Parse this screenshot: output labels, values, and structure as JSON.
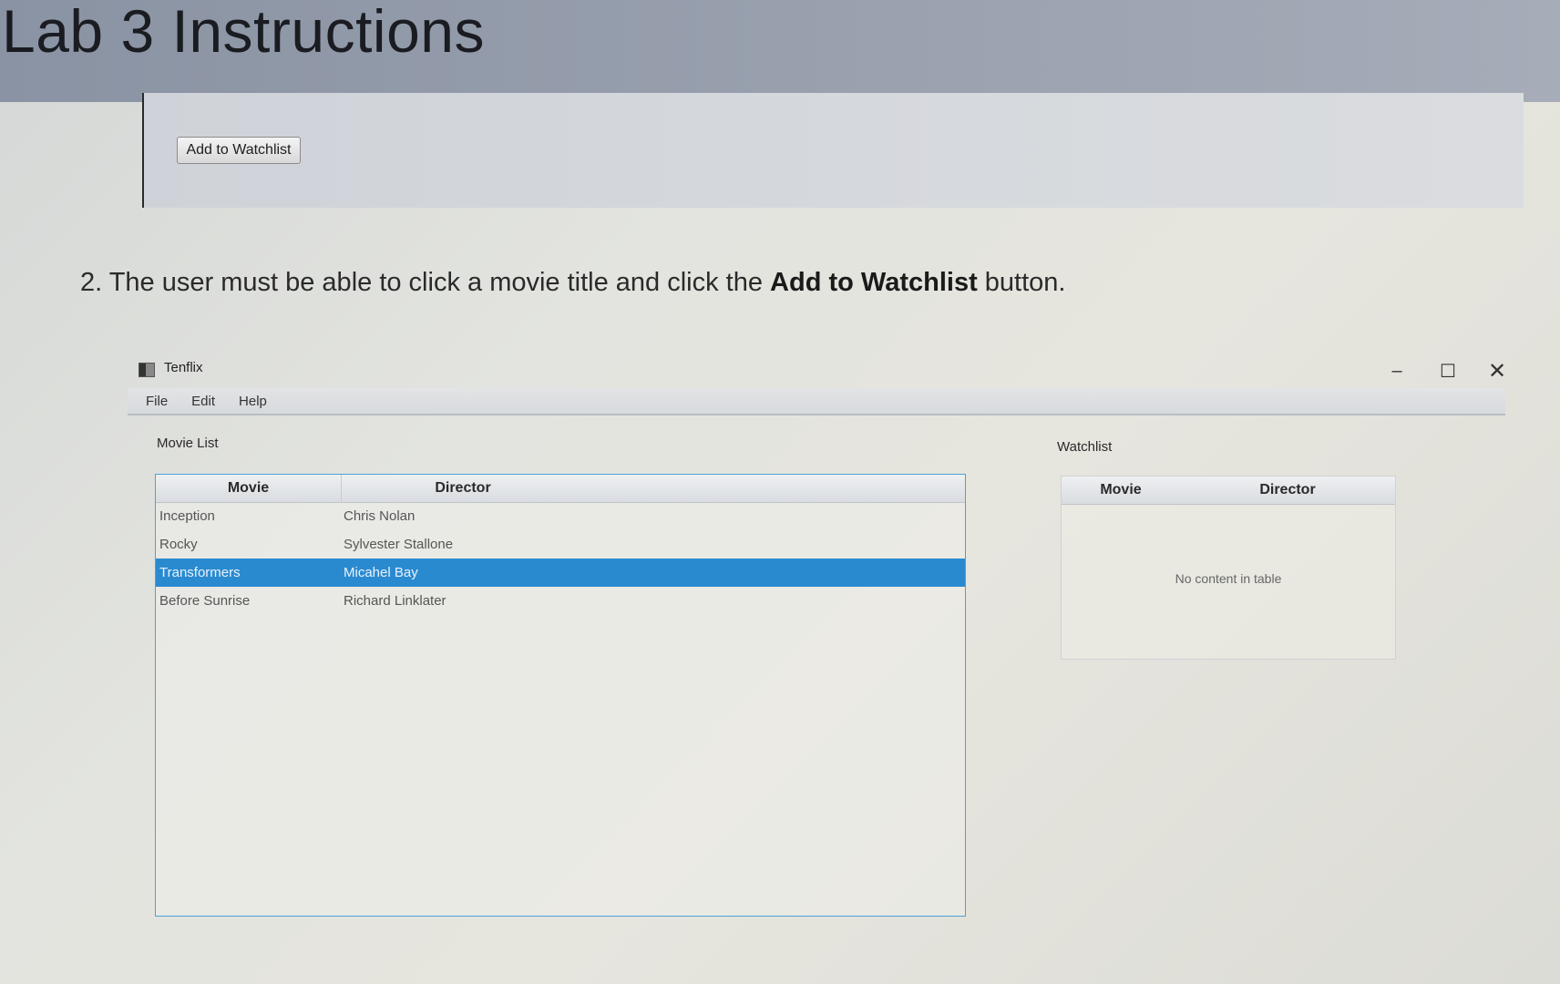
{
  "page": {
    "title": "Lab 3 Instructions"
  },
  "previous_step": {
    "add_button_label": "Add to Watchlist"
  },
  "instruction": {
    "prefix": "2. The user must be able to click a movie title and click the ",
    "bold": "Add to Watchlist",
    "suffix": " button."
  },
  "window": {
    "title": "Tenflix",
    "controls": {
      "minimize": "–",
      "maximize": "☐",
      "close": "✕"
    },
    "menu": [
      "File",
      "Edit",
      "Help"
    ]
  },
  "movie_list": {
    "label": "Movie List",
    "columns": [
      "Movie",
      "Director"
    ],
    "rows": [
      {
        "movie": "Inception",
        "director": "Chris Nolan",
        "selected": false
      },
      {
        "movie": "Rocky",
        "director": "Sylvester Stallone",
        "selected": false
      },
      {
        "movie": "Transformers",
        "director": "Micahel Bay",
        "selected": true
      },
      {
        "movie": "Before Sunrise",
        "director": "Richard Linklater",
        "selected": false
      }
    ]
  },
  "watchlist": {
    "label": "Watchlist",
    "columns": [
      "Movie",
      "Director"
    ],
    "empty_message": "No content in table"
  },
  "colors": {
    "selection": "#2a8ad0",
    "table_border": "#4aa3d6",
    "header_band": "#8a93a3"
  }
}
